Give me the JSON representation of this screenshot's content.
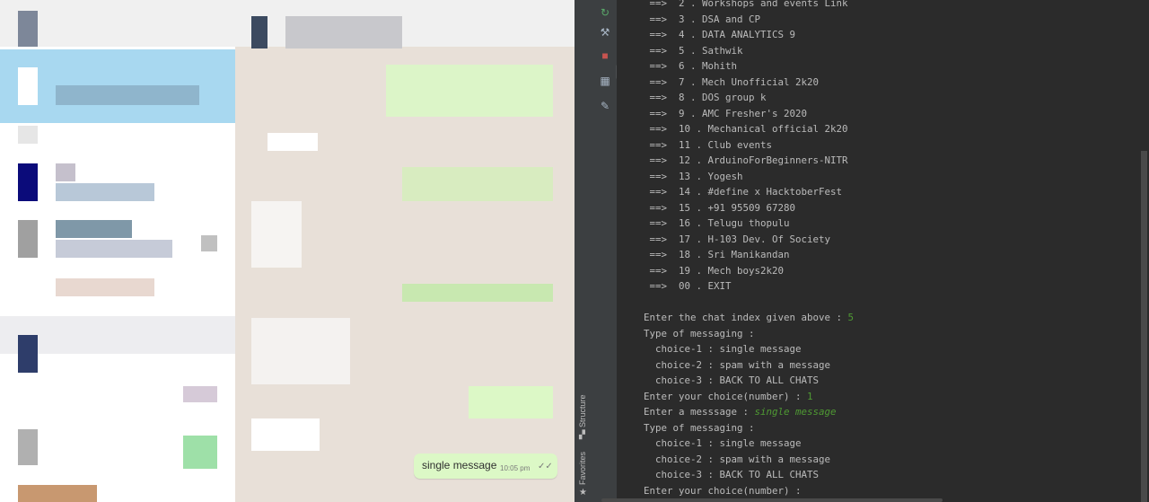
{
  "whatsapp": {
    "message": {
      "text": "single message",
      "time": "10:05 pm",
      "ticks": "✓✓"
    }
  },
  "ide": {
    "side_labels": {
      "structure": "Structure",
      "favorites": "Favorites"
    },
    "toolbar_icons": [
      "rerun-icon",
      "scroll-up-icon",
      "scroll-down-icon",
      "stop-icon",
      "soft-wrap-icon",
      "layout-icon",
      "scroll-to-end-icon",
      "pin-icon",
      "print-icon",
      "trash-icon"
    ],
    "console": {
      "lines": [
        {
          "text": " ==>  2 . Workshops and events Link",
          "type": "out"
        },
        {
          "text": " ==>  3 . DSA and CP",
          "type": "out"
        },
        {
          "text": " ==>  4 . DATA ANALYTICS 9",
          "type": "out"
        },
        {
          "text": " ==>  5 . Sathwik",
          "type": "out"
        },
        {
          "text": " ==>  6 . Mohith",
          "type": "out"
        },
        {
          "text": " ==>  7 . Mech Unofficial 2k20",
          "type": "out"
        },
        {
          "text": " ==>  8 . DOS group k",
          "type": "out"
        },
        {
          "text": " ==>  9 . AMC Fresher's 2020",
          "type": "out"
        },
        {
          "text": " ==>  10 . Mechanical official 2k20",
          "type": "out"
        },
        {
          "text": " ==>  11 . Club events",
          "type": "out"
        },
        {
          "text": " ==>  12 . ArduinoForBeginners-NITR",
          "type": "out"
        },
        {
          "text": " ==>  13 . Yogesh",
          "type": "out"
        },
        {
          "text": " ==>  14 . #define x HacktoberFest",
          "type": "out"
        },
        {
          "text": " ==>  15 . +91 95509 67280",
          "type": "out"
        },
        {
          "text": " ==>  16 . Telugu thopulu",
          "type": "out"
        },
        {
          "text": " ==>  17 . H-103 Dev. Of Society",
          "type": "out"
        },
        {
          "text": " ==>  18 . Sri Manikandan",
          "type": "out"
        },
        {
          "text": " ==>  19 . Mech boys2k20",
          "type": "out"
        },
        {
          "text": " ==>  00 . EXIT",
          "type": "out"
        },
        {
          "text": "",
          "type": "out"
        },
        {
          "text": "Enter the chat index given above : ",
          "type": "out",
          "input": "5"
        },
        {
          "text": "Type of messaging :",
          "type": "out"
        },
        {
          "text": "  choice-1 : single message",
          "type": "out"
        },
        {
          "text": "  choice-2 : spam with a message",
          "type": "out"
        },
        {
          "text": "  choice-3 : BACK TO ALL CHATS",
          "type": "out"
        },
        {
          "text": "Enter your choice(number) : ",
          "type": "out",
          "input": "1"
        },
        {
          "text": "Enter a messsage : ",
          "type": "out",
          "input": "single message",
          "italic": true
        },
        {
          "text": "Type of messaging :",
          "type": "out"
        },
        {
          "text": "  choice-1 : single message",
          "type": "out"
        },
        {
          "text": "  choice-2 : spam with a message",
          "type": "out"
        },
        {
          "text": "  choice-3 : BACK TO ALL CHATS",
          "type": "out"
        },
        {
          "text": "Enter your choice(number) : ",
          "type": "out"
        }
      ]
    }
  }
}
